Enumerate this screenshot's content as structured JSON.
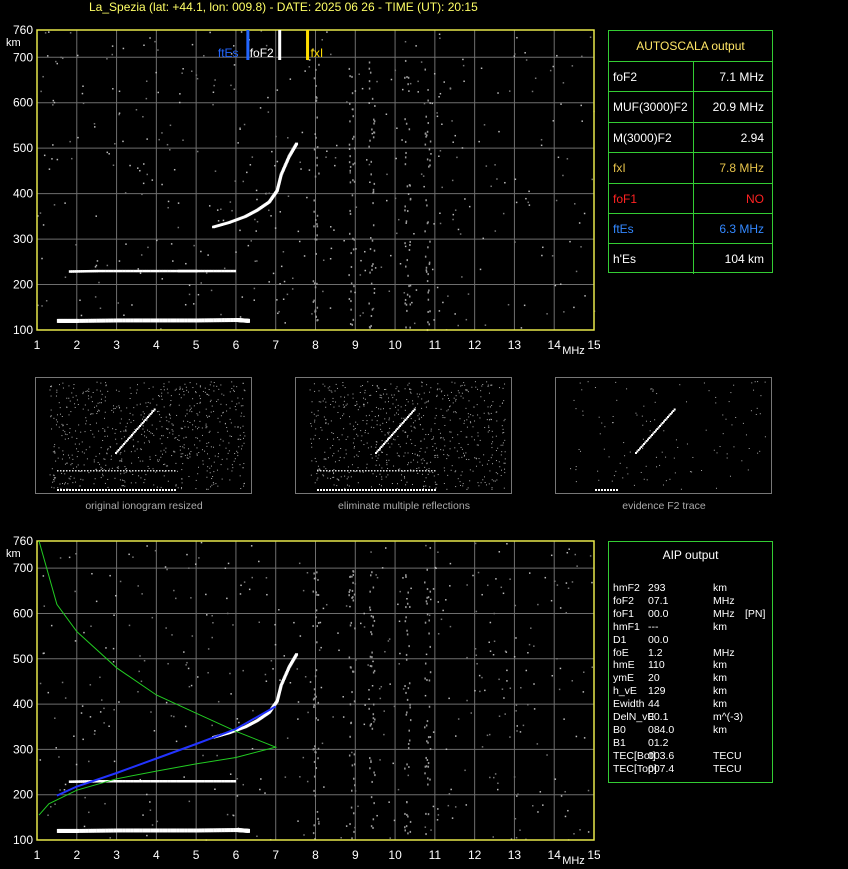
{
  "title": "La_Spezia (lat: +44.1, lon: 009.8) - DATE: 2025 06 26 - TIME (UT): 20:15",
  "colors": {
    "axis": "#e8e84a",
    "grid": "#6e6e6e",
    "panel_border": "#33cc33",
    "profile": "#22cc22",
    "trace": "#2233ff",
    "fEs": "#2266ff",
    "foF2": "#ffffff",
    "fxI": "#ffdd00",
    "red": "#ff2222"
  },
  "ionogram_axes": {
    "y_unit": "km",
    "x_unit": "MHz",
    "y_ticks": [
      "760",
      "700",
      "600",
      "500",
      "400",
      "300",
      "200",
      "100"
    ],
    "x_ticks": [
      "1",
      "2",
      "3",
      "4",
      "5",
      "6",
      "7",
      "8",
      "9",
      "10",
      "11",
      "12",
      "13",
      "14",
      "15"
    ]
  },
  "markers": {
    "fEs_label": "ftEs",
    "foF2_label": "foF2",
    "fxI_label": "fxI"
  },
  "autoscala": {
    "title": "AUTOSCALA output",
    "rows": [
      {
        "k": "foF2",
        "v": "7.1 MHz",
        "color": "#ffffff"
      },
      {
        "k": "MUF(3000)F2",
        "v": "20.9 MHz",
        "color": "#ffffff"
      },
      {
        "k": "M(3000)F2",
        "v": "2.94",
        "color": "#ffffff"
      },
      {
        "k": "fxI",
        "v": "7.8 MHz",
        "color": "#e6c24a"
      },
      {
        "k": "foF1",
        "v": "NO",
        "color": "#ff2222"
      },
      {
        "k": "ftEs",
        "v": "6.3 MHz",
        "color": "#3388ff"
      },
      {
        "k": "h'Es",
        "v": "104     km",
        "color": "#ffffff"
      }
    ]
  },
  "thumbnails": [
    {
      "caption": "original ionogram resized"
    },
    {
      "caption": "eliminate multiple reflections"
    },
    {
      "caption": "evidence F2 trace"
    }
  ],
  "aip": {
    "title": "AIP output",
    "rows": [
      {
        "k": "hmF2",
        "v": "293",
        "u": "km",
        "x": ""
      },
      {
        "k": "foF2",
        "v": "07.1",
        "u": "MHz",
        "x": ""
      },
      {
        "k": "foF1",
        "v": "00.0",
        "u": "MHz",
        "x": "[PN]"
      },
      {
        "k": "hmF1",
        "v": "---",
        "u": "km",
        "x": ""
      },
      {
        "k": "D1",
        "v": "00.0",
        "u": "",
        "x": ""
      },
      {
        "k": "foE",
        "v": "1.2",
        "u": "MHz",
        "x": ""
      },
      {
        "k": "hmE",
        "v": "110",
        "u": "km",
        "x": ""
      },
      {
        "k": "ymE",
        "v": "20",
        "u": "km",
        "x": ""
      },
      {
        "k": "h_vE",
        "v": "129",
        "u": "km",
        "x": ""
      },
      {
        "k": "Ewidth",
        "v": "44",
        "u": "km",
        "x": ""
      },
      {
        "k": "DelN_vE",
        "v": "00.1",
        "u": "m^(-3)",
        "x": ""
      },
      {
        "k": "B0",
        "v": "084.0",
        "u": "km",
        "x": ""
      },
      {
        "k": "B1",
        "v": "01.2",
        "u": "",
        "x": ""
      },
      {
        "k": "TEC[Bot]",
        "v": "003.6",
        "u": "TECU",
        "x": ""
      },
      {
        "k": "TEC[Top]",
        "v": "007.4",
        "u": "TECU",
        "x": ""
      }
    ]
  },
  "chart_data": [
    {
      "type": "scatter",
      "xlabel": "MHz",
      "ylabel": "km",
      "xlim": [
        1,
        15
      ],
      "ylim": [
        100,
        760
      ],
      "grid": true,
      "markers_MHz": {
        "ftEs": 6.3,
        "foF2": 7.1,
        "fxI": 7.8
      },
      "traces": [
        {
          "name": "",
          "points": [
            [
              1.5,
              120
            ],
            [
              2,
              120
            ],
            [
              3,
              121
            ],
            [
              4,
              121
            ],
            [
              5,
              121
            ],
            [
              6,
              122
            ],
            [
              6.3,
              120
            ]
          ]
        },
        {
          "name": "",
          "points": [
            [
              1.8,
              227
            ],
            [
              2.5,
              228
            ],
            [
              3.5,
              228
            ],
            [
              4.5,
              228
            ],
            [
              5,
              228
            ],
            [
              6,
              228
            ]
          ]
        },
        {
          "name": "",
          "points": [
            [
              5.4,
              325
            ],
            [
              5.8,
              335
            ],
            [
              6.2,
              348
            ],
            [
              6.5,
              362
            ],
            [
              6.8,
              380
            ],
            [
              7.0,
              405
            ],
            [
              7.1,
              440
            ],
            [
              7.3,
              480
            ],
            [
              7.5,
              510
            ]
          ]
        }
      ]
    },
    {
      "type": "line",
      "xlabel": "MHz",
      "ylabel": "km",
      "xlim": [
        1,
        15
      ],
      "ylim": [
        100,
        760
      ],
      "grid": true,
      "series": [
        {
          "name": "",
          "color": "#22cc22",
          "points": [
            [
              1.05,
              760
            ],
            [
              1.5,
              620
            ],
            [
              2,
              560
            ],
            [
              3,
              480
            ],
            [
              4,
              420
            ],
            [
              5,
              380
            ],
            [
              6,
              340
            ],
            [
              7,
              305
            ],
            [
              6,
              282
            ],
            [
              5,
              268
            ],
            [
              4,
              252
            ],
            [
              3,
              235
            ],
            [
              2,
              210
            ],
            [
              1.3,
              180
            ],
            [
              1.05,
              155
            ]
          ]
        },
        {
          "name": "",
          "color": "#2233ff",
          "points": [
            [
              1.5,
              198
            ],
            [
              2,
              218
            ],
            [
              3,
              248
            ],
            [
              4,
              280
            ],
            [
              5,
              312
            ],
            [
              6,
              345
            ],
            [
              7,
              395
            ]
          ]
        }
      ]
    }
  ]
}
